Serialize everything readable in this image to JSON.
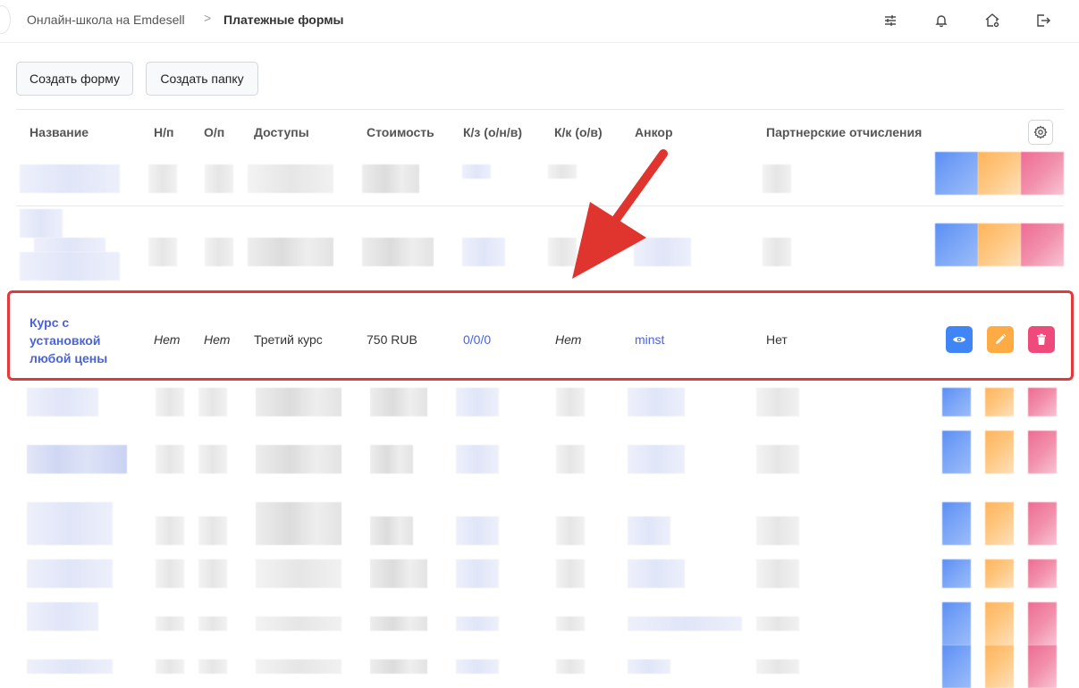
{
  "breadcrumb": {
    "parent": "Онлайн-школа на Emdesell",
    "separator": ">",
    "current": "Платежные формы"
  },
  "toolbar": {
    "create_form": "Создать форму",
    "create_folder": "Создать папку"
  },
  "table": {
    "columns": [
      "Название",
      "Н/п",
      "О/п",
      "Доступы",
      "Стоимость",
      "К/з (о/н/в)",
      "К/к (о/в)",
      "Анкор",
      "Партнерские отчисления"
    ],
    "highlighted_row": {
      "name": "Курс с установкой любой цены",
      "np": "Нет",
      "op": "Нет",
      "access": "Третий курс",
      "price": "750 RUB",
      "kz": "0/0/0",
      "kk": "Нет",
      "anchor": "minst",
      "partner": "Нет"
    }
  },
  "colors": {
    "accent_link": "#4a63d8",
    "view_button": "#3f85f6",
    "edit_button": "#ffab44",
    "delete_button": "#ee4a7c",
    "highlight_border": "#e03a3a",
    "annotation_arrow": "#e0342e"
  },
  "icons": {
    "top_right": [
      "sliders-icon",
      "bell-icon",
      "home-settings-icon",
      "logout-icon"
    ],
    "table_settings": "gear-icon",
    "row_actions": [
      "eye-icon",
      "pencil-icon",
      "trash-icon"
    ]
  }
}
